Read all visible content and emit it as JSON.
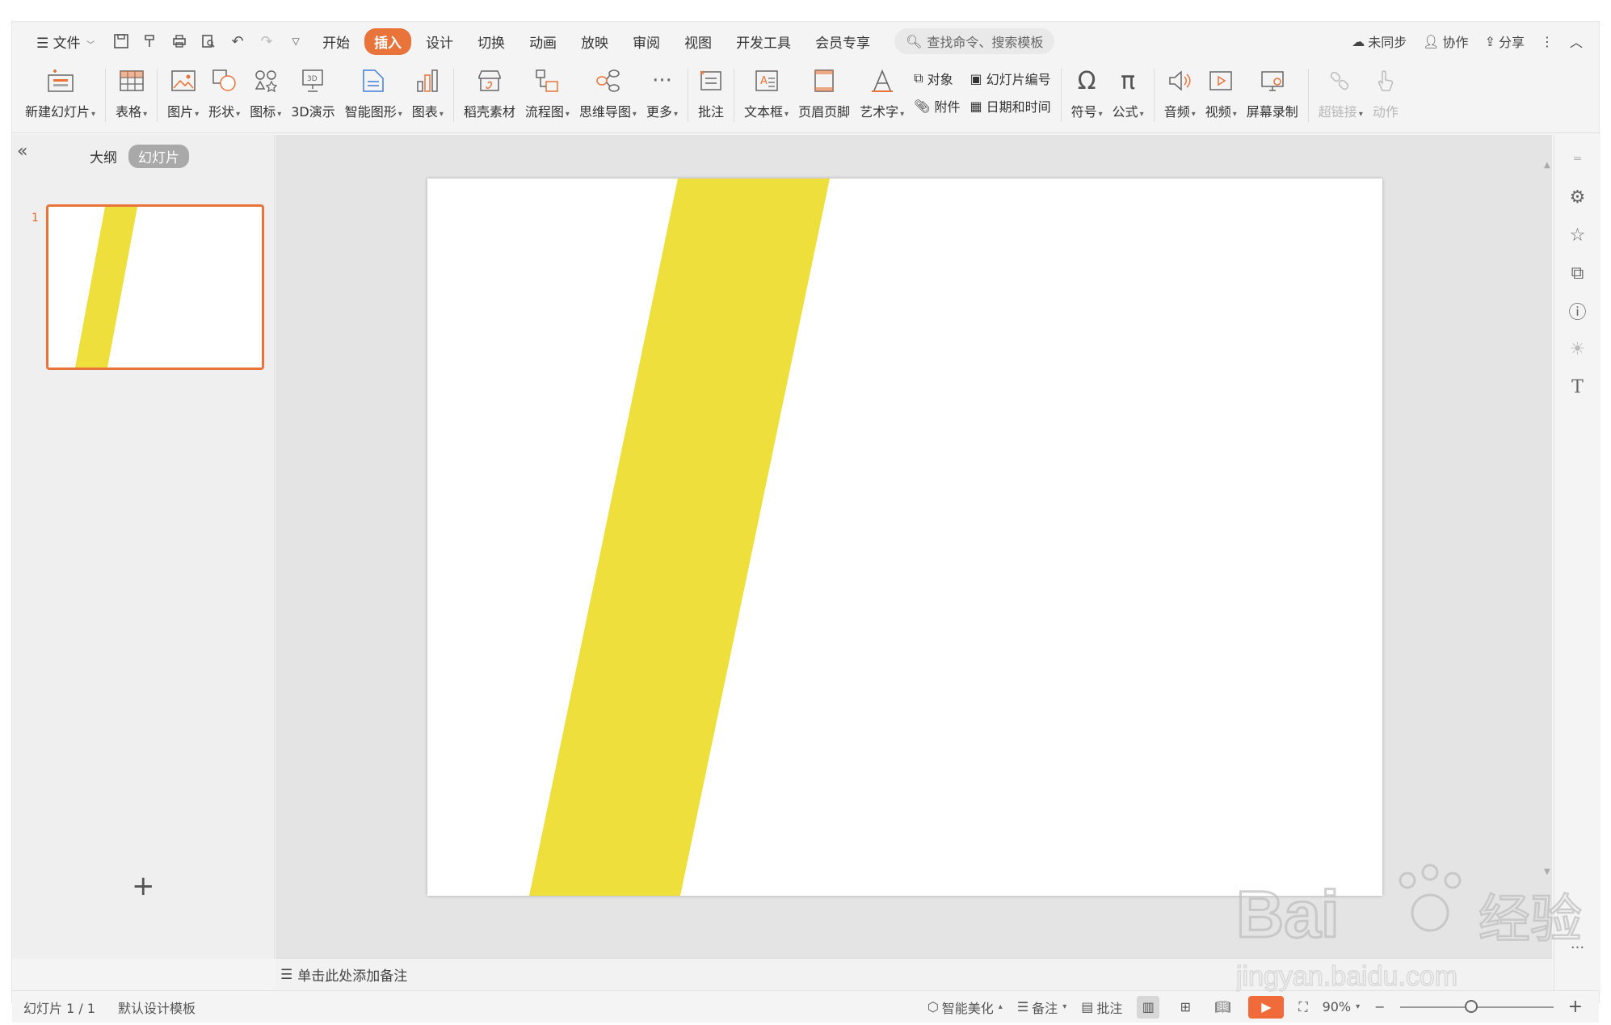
{
  "menubar": {
    "file_label": "文件",
    "tabs": [
      "开始",
      "插入",
      "设计",
      "切换",
      "动画",
      "放映",
      "审阅",
      "视图",
      "开发工具",
      "会员专享"
    ],
    "active_tab": "插入",
    "search_placeholder": "查找命令、搜索模板",
    "right": {
      "sync": "未同步",
      "collab": "协作",
      "share": "分享"
    }
  },
  "ribbon": {
    "new_slide": "新建幻灯片",
    "table": "表格",
    "picture": "图片",
    "shape": "形状",
    "icon": "图标",
    "demo3d": "3D演示",
    "smartart": "智能图形",
    "chart": "图表",
    "material": "稻壳素材",
    "flowchart": "流程图",
    "mindmap": "思维导图",
    "more": "更多",
    "comment": "批注",
    "textbox": "文本框",
    "header_footer": "页眉页脚",
    "wordart": "艺术字",
    "object": "对象",
    "attachment": "附件",
    "slide_number": "幻灯片编号",
    "datetime": "日期和时间",
    "symbol": "符号",
    "equation": "公式",
    "audio": "音频",
    "video": "视频",
    "screen_record": "屏幕录制",
    "hyperlink": "超链接",
    "action": "动作"
  },
  "left_panel": {
    "tab_outline": "大纲",
    "tab_slides": "幻灯片",
    "slide_number": "1"
  },
  "notes": {
    "placeholder": "单击此处添加备注"
  },
  "statusbar": {
    "slide_info": "幻灯片 1 / 1",
    "template": "默认设计模板",
    "beautify": "智能美化",
    "notes": "备注",
    "comment": "批注",
    "zoom": "90%"
  },
  "colors": {
    "accent": "#e8743b",
    "stripe": "#eedf3c"
  },
  "watermark": {
    "brand": "Bai",
    "brand2": "经验",
    "url": "jingyan.baidu.com"
  }
}
